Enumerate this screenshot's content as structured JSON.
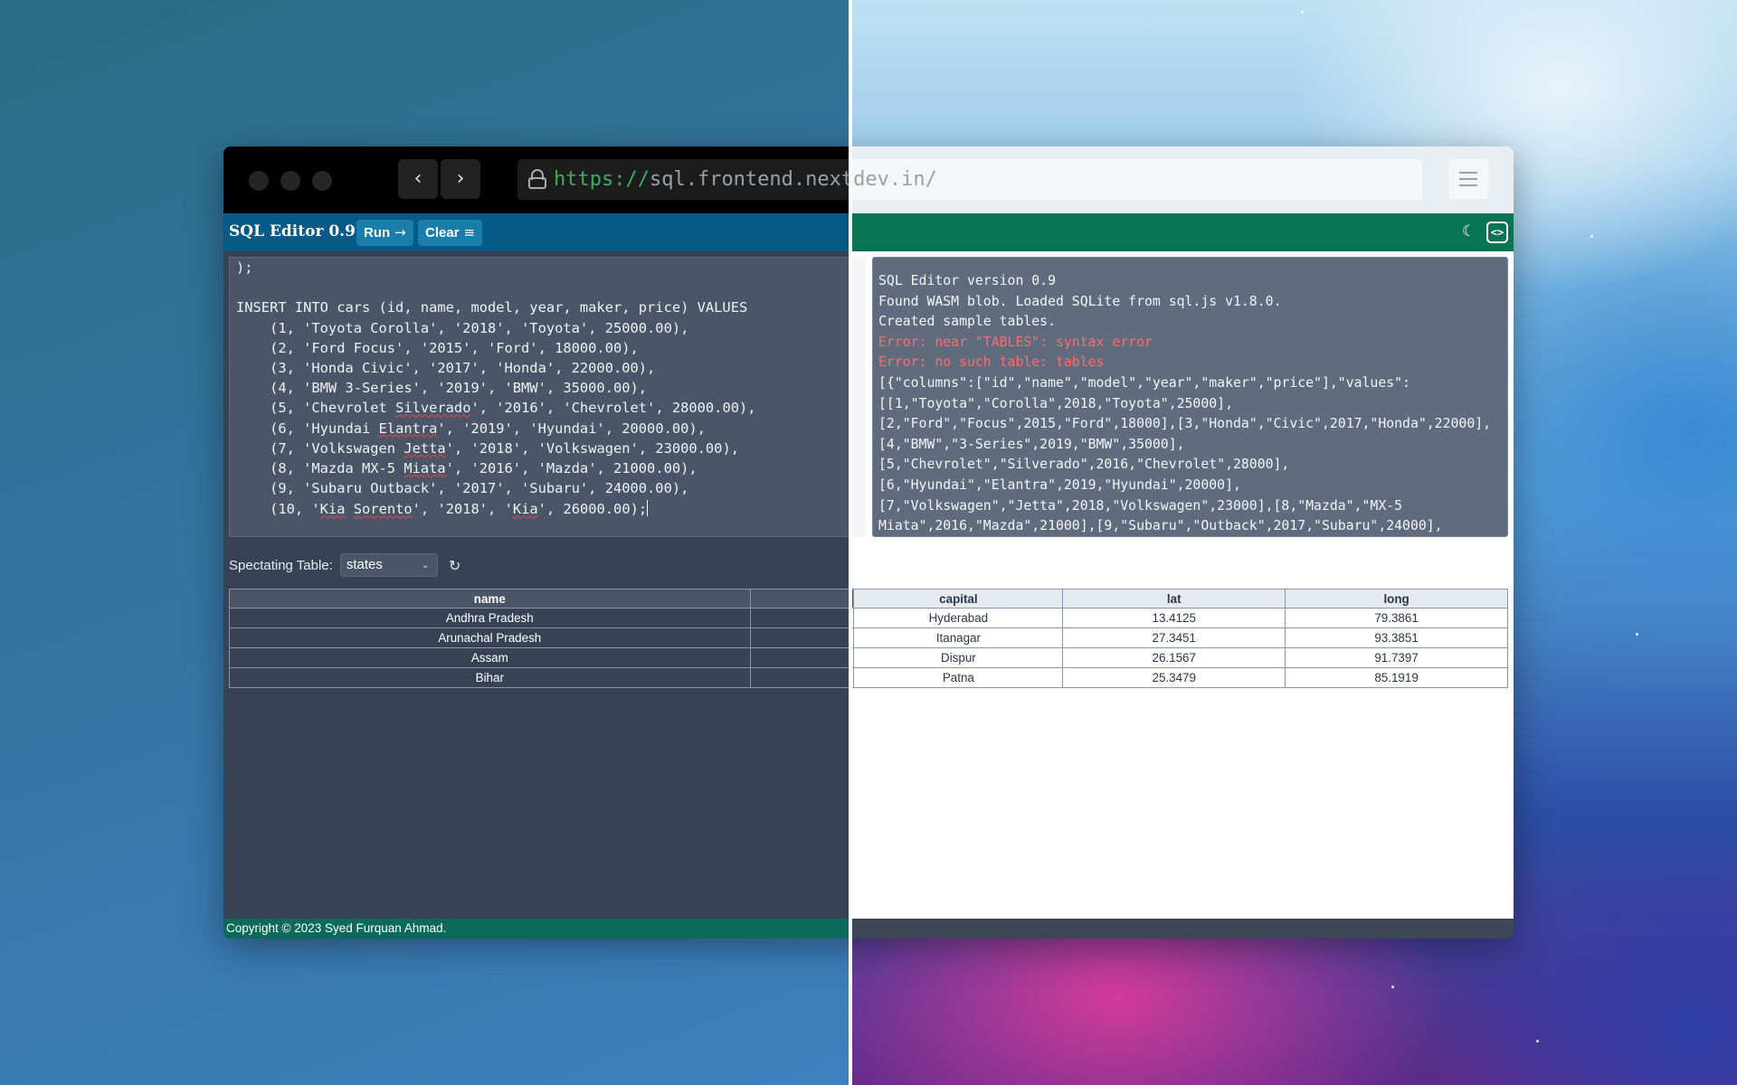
{
  "browser": {
    "url_protocol": "https://",
    "url_host": "sql.frontend.nextdev.in/",
    "back_icon": "chevron-left-icon",
    "forward_icon": "chevron-right-icon",
    "settings_icon": "sliders-icon"
  },
  "app": {
    "title": "SQL Editor 0.9",
    "run_label": "Run",
    "run_icon": "→",
    "clear_label": "Clear",
    "clear_icon": "≡",
    "theme_icon": "☾",
    "code_toggle_label": "<>",
    "colors": {
      "header_left": "#085a86",
      "header_right": "#087452",
      "button": "#1b7eaa",
      "editor_bg": "#4a5568",
      "console_bg": "#616b7e",
      "error": "#ff6b6b"
    }
  },
  "editor": {
    "lines": [
      ");",
      "",
      "INSERT INTO cars (id, name, model, year, maker, price) VALUES",
      "    (1, 'Toyota Corolla', '2018', 'Toyota', 25000.00),",
      "    (2, 'Ford Focus', '2015', 'Ford', 18000.00),",
      "    (3, 'Honda Civic', '2017', 'Honda', 22000.00),",
      "    (4, 'BMW 3-Series', '2019', 'BMW', 35000.00),",
      "    (5, 'Chevrolet Silverado', '2016', 'Chevrolet', 28000.00),",
      "    (6, 'Hyundai Elantra', '2019', 'Hyundai', 20000.00),",
      "    (7, 'Volkswagen Jetta', '2018', 'Volkswagen', 23000.00),",
      "    (8, 'Mazda MX-5 Miata', '2016', 'Mazda', 21000.00),",
      "    (9, 'Subaru Outback', '2017', 'Subaru', 24000.00),",
      "    (10, 'Kia Sorento', '2018', 'Kia', 26000.00);"
    ]
  },
  "console": {
    "lines": [
      {
        "text": "SQL Editor version 0.9",
        "error": false
      },
      {
        "text": "Found WASM blob. Loaded SQLite from sql.js v1.8.0.",
        "error": false
      },
      {
        "text": "Created sample tables.",
        "error": false
      },
      {
        "text": "Error: near \"TABLES\": syntax error",
        "error": true
      },
      {
        "text": "Error: no such table: tables",
        "error": true
      },
      {
        "text": "[{\"columns\":[\"id\",\"name\",\"model\",\"year\",\"maker\",\"price\"],\"values\":",
        "error": false
      },
      {
        "text": "[[1,\"Toyota\",\"Corolla\",2018,\"Toyota\",25000],",
        "error": false
      },
      {
        "text": "[2,\"Ford\",\"Focus\",2015,\"Ford\",18000],[3,\"Honda\",\"Civic\",2017,\"Honda\",22000],",
        "error": false
      },
      {
        "text": "[4,\"BMW\",\"3-Series\",2019,\"BMW\",35000],",
        "error": false
      },
      {
        "text": "[5,\"Chevrolet\",\"Silverado\",2016,\"Chevrolet\",28000],",
        "error": false
      },
      {
        "text": "[6,\"Hyundai\",\"Elantra\",2019,\"Hyundai\",20000],",
        "error": false
      },
      {
        "text": "[7,\"Volkswagen\",\"Jetta\",2018,\"Volkswagen\",23000],[8,\"Mazda\",\"MX-5",
        "error": false
      },
      {
        "text": "Miata\",2016,\"Mazda\",21000],[9,\"Subaru\",\"Outback\",2017,\"Subaru\",24000],",
        "error": false
      }
    ]
  },
  "spectator": {
    "label": "Spectating Table:",
    "selected_table": "states",
    "refresh_icon": "refresh-icon"
  },
  "table": {
    "columns": [
      "name",
      "",
      "capital",
      "lat",
      "long"
    ],
    "rows": [
      [
        "Andhra Pradesh",
        "",
        "Hyderabad",
        "13.4125",
        "79.3861"
      ],
      [
        "Arunachal Pradesh",
        "",
        "Itanagar",
        "27.3451",
        "93.3851"
      ],
      [
        "Assam",
        "",
        "Dispur",
        "26.1567",
        "91.7397"
      ],
      [
        "Bihar",
        "",
        "Patna",
        "25.3479",
        "85.1919"
      ]
    ]
  },
  "footer": {
    "text": "Copyright © 2023 Syed Furquan Ahmad."
  }
}
